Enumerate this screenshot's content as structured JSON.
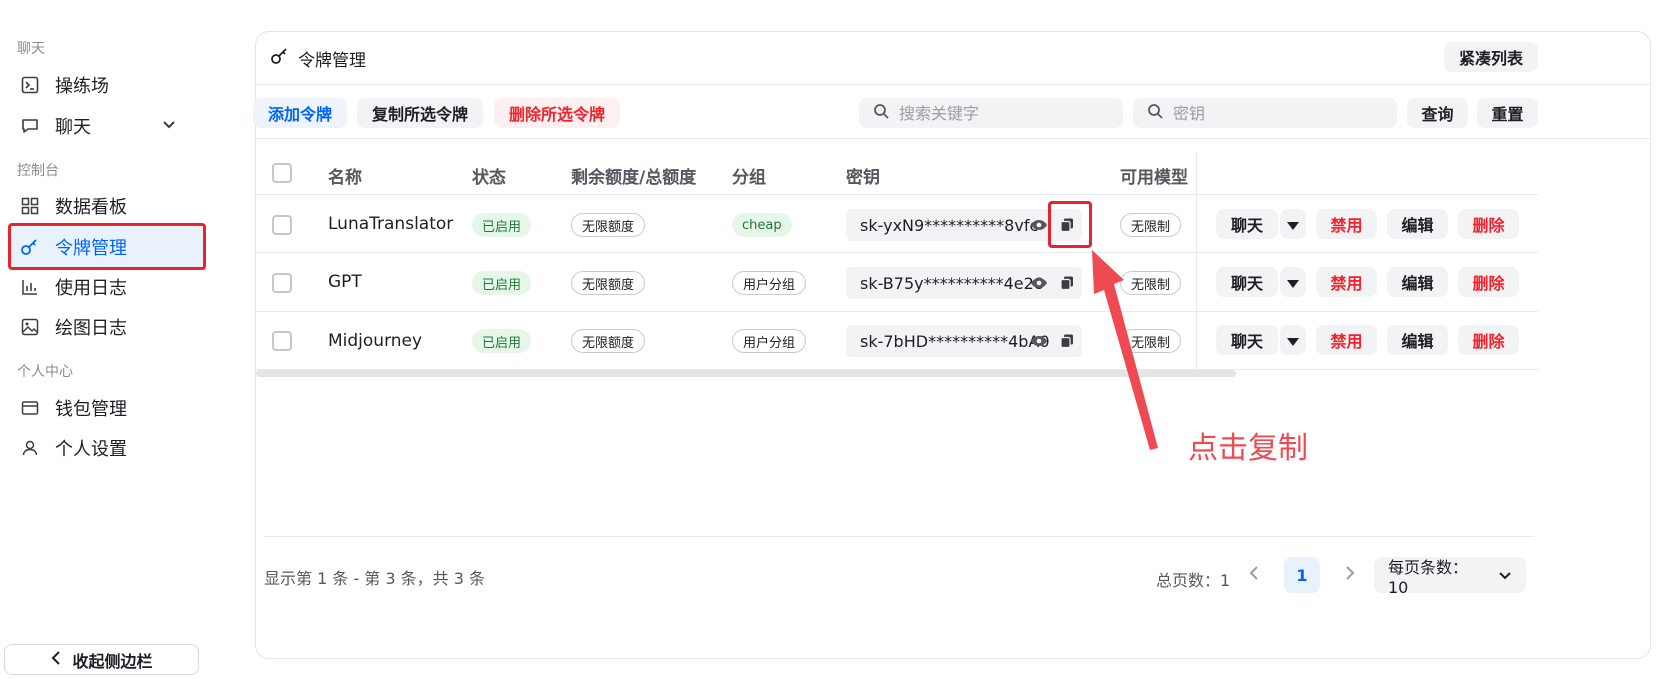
{
  "sidebar": {
    "sections": [
      "聊天",
      "控制台",
      "个人中心"
    ],
    "items": [
      {
        "label": "操练场",
        "icon": "terminal-icon"
      },
      {
        "label": "聊天",
        "icon": "chat-icon"
      },
      {
        "label": "数据看板",
        "icon": "dashboard-icon"
      },
      {
        "label": "令牌管理",
        "icon": "key-icon"
      },
      {
        "label": "使用日志",
        "icon": "bar-chart-icon"
      },
      {
        "label": "绘图日志",
        "icon": "image-icon"
      },
      {
        "label": "钱包管理",
        "icon": "wallet-icon"
      },
      {
        "label": "个人设置",
        "icon": "user-icon"
      }
    ],
    "collapse_label": "收起侧边栏"
  },
  "header": {
    "title": "令牌管理",
    "compact_label": "紧凑列表"
  },
  "toolbar": {
    "add_label": "添加令牌",
    "copy_selected_label": "复制所选令牌",
    "delete_selected_label": "删除所选令牌",
    "search_keyword_placeholder": "搜索关键字",
    "search_key_placeholder": "密钥",
    "query_label": "查询",
    "reset_label": "重置"
  },
  "table": {
    "columns": [
      "名称",
      "状态",
      "剩余额度/总额度",
      "分组",
      "密钥",
      "可用模型"
    ],
    "rows": [
      {
        "name": "LunaTranslator",
        "status": "已启用",
        "quota": "无限额度",
        "group": "cheap",
        "key": "sk-yxN9**********8vfc",
        "models": "无限制"
      },
      {
        "name": "GPT",
        "status": "已启用",
        "quota": "无限额度",
        "group": "用户分组",
        "key": "sk-B75y**********4e28",
        "models": "无限制"
      },
      {
        "name": "Midjourney",
        "status": "已启用",
        "quota": "无限额度",
        "group": "用户分组",
        "key": "sk-7bHD**********4bA0",
        "models": "无限制"
      }
    ],
    "actions": {
      "chat": "聊天",
      "disable": "禁用",
      "edit": "编辑",
      "delete": "删除"
    }
  },
  "footer": {
    "summary": "显示第 1 条 - 第 3 条，共 3 条",
    "total_pages": "总页数：1",
    "current_page": "1",
    "per_page": "每页条数：10"
  },
  "annotation": {
    "text": "点击复制"
  },
  "colors": {
    "accent": "#0064fa",
    "danger": "#f5222d",
    "annotation": "#ef4a52"
  }
}
